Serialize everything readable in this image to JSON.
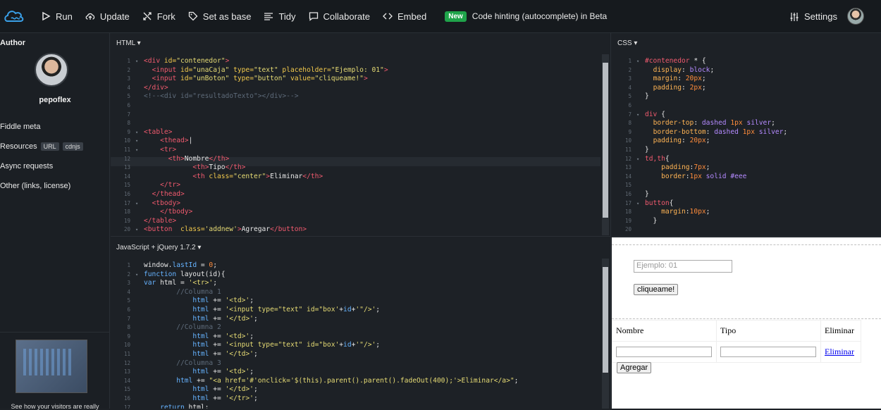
{
  "topbar": {
    "buttons": [
      {
        "label": "Run",
        "icon": "play-icon"
      },
      {
        "label": "Update",
        "icon": "cloud-upload-icon"
      },
      {
        "label": "Fork",
        "icon": "fork-icon"
      },
      {
        "label": "Set as base",
        "icon": "tag-icon"
      },
      {
        "label": "Tidy",
        "icon": "align-icon"
      },
      {
        "label": "Collaborate",
        "icon": "chat-icon"
      },
      {
        "label": "Embed",
        "icon": "code-icon"
      }
    ],
    "badge": "New",
    "hint": "Code hinting (autocomplete) in Beta",
    "settings_label": "Settings"
  },
  "sidebar": {
    "author_label": "Author",
    "username": "pepoflex",
    "items": [
      {
        "label": "Fiddle meta"
      },
      {
        "label": "Resources",
        "tags": [
          "URL",
          "cdnjs"
        ]
      },
      {
        "label": "Async requests"
      },
      {
        "label": "Other (links, license)"
      }
    ],
    "ad_text": "See how your visitors are really"
  },
  "panels": {
    "html_title": "HTML ▾",
    "css_title": "CSS ▾",
    "js_title": "JavaScript + jQuery 1.7.2 ▾"
  },
  "html_lines": [
    {
      "n": "1",
      "f": "▾",
      "s": [
        [
          "t",
          "<div "
        ],
        [
          "a",
          "id="
        ],
        [
          "s",
          "\"contenedor\""
        ],
        [
          "t",
          ">"
        ]
      ]
    },
    {
      "n": "2",
      "f": "",
      "s": [
        [
          "x",
          "  "
        ],
        [
          "t",
          "<input "
        ],
        [
          "a",
          "id="
        ],
        [
          "s",
          "\"unaCaja\" "
        ],
        [
          "a",
          "type="
        ],
        [
          "s",
          "\"text\" "
        ],
        [
          "a",
          "placeholder="
        ],
        [
          "s",
          "\"Ejemplo: 01\""
        ],
        [
          "t",
          ">"
        ]
      ]
    },
    {
      "n": "3",
      "f": "",
      "s": [
        [
          "x",
          "  "
        ],
        [
          "t",
          "<input "
        ],
        [
          "a",
          "id="
        ],
        [
          "s",
          "\"unBoton\" "
        ],
        [
          "a",
          "type="
        ],
        [
          "s",
          "\"button\" "
        ],
        [
          "a",
          "value="
        ],
        [
          "s",
          "\"cliqueame!\""
        ],
        [
          "t",
          ">"
        ]
      ]
    },
    {
      "n": "4",
      "f": "",
      "s": [
        [
          "t",
          "</div>"
        ]
      ]
    },
    {
      "n": "5",
      "f": "",
      "s": [
        [
          "c",
          "<!--<div id=\"resultadoTexto\"></div>-->"
        ]
      ]
    },
    {
      "n": "6",
      "f": "",
      "s": []
    },
    {
      "n": "7",
      "f": "",
      "s": []
    },
    {
      "n": "8",
      "f": "",
      "s": []
    },
    {
      "n": "9",
      "f": "▾",
      "s": [
        [
          "t",
          "<table>"
        ]
      ]
    },
    {
      "n": "10",
      "f": "▾",
      "s": [
        [
          "x",
          "    "
        ],
        [
          "t",
          "<thead>"
        ],
        [
          "x",
          "|"
        ]
      ]
    },
    {
      "n": "11",
      "f": "▾",
      "s": [
        [
          "x",
          "    "
        ],
        [
          "t",
          "<tr>"
        ]
      ]
    },
    {
      "n": "12",
      "f": "",
      "s": [
        [
          "x",
          "      "
        ],
        [
          "t",
          "<th>"
        ],
        [
          "x",
          "Nombre"
        ],
        [
          "t",
          "</th>"
        ]
      ]
    },
    {
      "n": "13",
      "f": "",
      "s": [
        [
          "x",
          "            "
        ],
        [
          "t",
          "<th>"
        ],
        [
          "x",
          "Tipo"
        ],
        [
          "t",
          "</th>"
        ]
      ]
    },
    {
      "n": "14",
      "f": "",
      "s": [
        [
          "x",
          "            "
        ],
        [
          "t",
          "<th "
        ],
        [
          "a",
          "class="
        ],
        [
          "s",
          "\"center\""
        ],
        [
          "t",
          ">"
        ],
        [
          "x",
          "Eliminar"
        ],
        [
          "t",
          "</th>"
        ]
      ]
    },
    {
      "n": "15",
      "f": "",
      "s": [
        [
          "x",
          "    "
        ],
        [
          "t",
          "</tr>"
        ]
      ]
    },
    {
      "n": "16",
      "f": "",
      "s": [
        [
          "x",
          "  "
        ],
        [
          "t",
          "</thead>"
        ]
      ]
    },
    {
      "n": "17",
      "f": "▾",
      "s": [
        [
          "x",
          "  "
        ],
        [
          "t",
          "<tbody>"
        ]
      ]
    },
    {
      "n": "18",
      "f": "",
      "s": [
        [
          "x",
          "    "
        ],
        [
          "t",
          "</tbody>"
        ]
      ]
    },
    {
      "n": "19",
      "f": "",
      "s": [
        [
          "t",
          "</table>"
        ]
      ]
    },
    {
      "n": "20",
      "f": "▾",
      "s": [
        [
          "t",
          "<button  "
        ],
        [
          "a",
          "class="
        ],
        [
          "s",
          "'addnew'"
        ],
        [
          "t",
          ">"
        ],
        [
          "x",
          "Agregar"
        ],
        [
          "t",
          "</button>"
        ]
      ]
    }
  ],
  "css_lines": [
    {
      "n": "1",
      "f": "▾",
      "s": [
        [
          "t",
          "#contenedor"
        ],
        [
          "x",
          " * {"
        ]
      ]
    },
    {
      "n": "2",
      "f": "",
      "s": [
        [
          "x",
          "  "
        ],
        [
          "p",
          "display"
        ],
        [
          "x",
          ": "
        ],
        [
          "v",
          "block"
        ],
        [
          "x",
          ";"
        ]
      ]
    },
    {
      "n": "3",
      "f": "",
      "s": [
        [
          "x",
          "  "
        ],
        [
          "p",
          "margin"
        ],
        [
          "x",
          ": "
        ],
        [
          "o",
          "20px"
        ],
        [
          "x",
          ";"
        ]
      ]
    },
    {
      "n": "4",
      "f": "",
      "s": [
        [
          "x",
          "  "
        ],
        [
          "p",
          "padding"
        ],
        [
          "x",
          ": "
        ],
        [
          "o",
          "2px"
        ],
        [
          "x",
          ";"
        ]
      ]
    },
    {
      "n": "5",
      "f": "",
      "s": [
        [
          "x",
          "}"
        ]
      ]
    },
    {
      "n": "6",
      "f": "",
      "s": []
    },
    {
      "n": "7",
      "f": "▾",
      "s": [
        [
          "t",
          "div"
        ],
        [
          "x",
          " {"
        ]
      ]
    },
    {
      "n": "8",
      "f": "",
      "s": [
        [
          "x",
          "  "
        ],
        [
          "p",
          "border-top"
        ],
        [
          "x",
          ": "
        ],
        [
          "v",
          "dashed "
        ],
        [
          "o",
          "1px "
        ],
        [
          "v",
          "silver"
        ],
        [
          "x",
          ";"
        ]
      ]
    },
    {
      "n": "9",
      "f": "",
      "s": [
        [
          "x",
          "  "
        ],
        [
          "p",
          "border-bottom"
        ],
        [
          "x",
          ": "
        ],
        [
          "v",
          "dashed "
        ],
        [
          "o",
          "1px "
        ],
        [
          "v",
          "silver"
        ],
        [
          "x",
          ";"
        ]
      ]
    },
    {
      "n": "10",
      "f": "",
      "s": [
        [
          "x",
          "  "
        ],
        [
          "p",
          "padding"
        ],
        [
          "x",
          ": "
        ],
        [
          "o",
          "20px"
        ],
        [
          "x",
          ";"
        ]
      ]
    },
    {
      "n": "11",
      "f": "",
      "s": [
        [
          "x",
          "}"
        ]
      ]
    },
    {
      "n": "12",
      "f": "▾",
      "s": [
        [
          "t",
          "td,th"
        ],
        [
          "x",
          "{"
        ]
      ]
    },
    {
      "n": "13",
      "f": "",
      "s": [
        [
          "x",
          "    "
        ],
        [
          "p",
          "padding"
        ],
        [
          "x",
          ":"
        ],
        [
          "o",
          "7px"
        ],
        [
          "x",
          ";"
        ]
      ]
    },
    {
      "n": "14",
      "f": "",
      "s": [
        [
          "x",
          "    "
        ],
        [
          "p",
          "border"
        ],
        [
          "x",
          ":"
        ],
        [
          "o",
          "1px "
        ],
        [
          "v",
          "solid "
        ],
        [
          "v",
          "#eee"
        ]
      ]
    },
    {
      "n": "15",
      "f": "",
      "s": []
    },
    {
      "n": "16",
      "f": "",
      "s": [
        [
          "x",
          "}"
        ]
      ]
    },
    {
      "n": "17",
      "f": "▾",
      "s": [
        [
          "t",
          "button"
        ],
        [
          "x",
          "{"
        ]
      ]
    },
    {
      "n": "18",
      "f": "",
      "s": [
        [
          "x",
          "    "
        ],
        [
          "p",
          "margin"
        ],
        [
          "x",
          ":"
        ],
        [
          "o",
          "10px"
        ],
        [
          "x",
          ";"
        ]
      ]
    },
    {
      "n": "19",
      "f": "",
      "s": [
        [
          "x",
          "  }"
        ]
      ]
    },
    {
      "n": "20",
      "f": "",
      "s": []
    }
  ],
  "js_lines": [
    {
      "n": "1",
      "f": "",
      "s": [
        [
          "x",
          "window."
        ],
        [
          "k",
          "lastId"
        ],
        [
          "x",
          " = "
        ],
        [
          "o",
          "0"
        ],
        [
          "x",
          ";"
        ]
      ]
    },
    {
      "n": "2",
      "f": "▾",
      "s": [
        [
          "k",
          "function "
        ],
        [
          "x",
          "layout(id){"
        ]
      ]
    },
    {
      "n": "3",
      "f": "",
      "s": [
        [
          "k",
          "var "
        ],
        [
          "x",
          "html = "
        ],
        [
          "s",
          "'<tr>'"
        ],
        [
          "x",
          ";"
        ]
      ]
    },
    {
      "n": "4",
      "f": "",
      "s": [
        [
          "x",
          "        "
        ],
        [
          "c",
          "//Columna 1"
        ]
      ]
    },
    {
      "n": "5",
      "f": "",
      "s": [
        [
          "x",
          "            "
        ],
        [
          "k",
          "html"
        ],
        [
          "x",
          " += "
        ],
        [
          "s",
          "'<td>'"
        ],
        [
          "x",
          ";"
        ]
      ]
    },
    {
      "n": "6",
      "f": "",
      "s": [
        [
          "x",
          "            "
        ],
        [
          "k",
          "html"
        ],
        [
          "x",
          " += "
        ],
        [
          "s",
          "'<input type=\"text\" id=\"box'"
        ],
        [
          "x",
          "+"
        ],
        [
          "k",
          "id"
        ],
        [
          "x",
          "+"
        ],
        [
          "s",
          "'\"/>'"
        ],
        [
          "x",
          ";"
        ]
      ]
    },
    {
      "n": "7",
      "f": "",
      "s": [
        [
          "x",
          "            "
        ],
        [
          "k",
          "html"
        ],
        [
          "x",
          " += "
        ],
        [
          "s",
          "'</td>'"
        ],
        [
          "x",
          ";"
        ]
      ]
    },
    {
      "n": "8",
      "f": "",
      "s": [
        [
          "x",
          "        "
        ],
        [
          "c",
          "//Columna 2"
        ]
      ]
    },
    {
      "n": "9",
      "f": "",
      "s": [
        [
          "x",
          "            "
        ],
        [
          "k",
          "html"
        ],
        [
          "x",
          " += "
        ],
        [
          "s",
          "'<td>'"
        ],
        [
          "x",
          ";"
        ]
      ]
    },
    {
      "n": "10",
      "f": "",
      "s": [
        [
          "x",
          "            "
        ],
        [
          "k",
          "html"
        ],
        [
          "x",
          " += "
        ],
        [
          "s",
          "'<input type=\"text\" id=\"box'"
        ],
        [
          "x",
          "+"
        ],
        [
          "k",
          "id"
        ],
        [
          "x",
          "+"
        ],
        [
          "s",
          "'\"/>'"
        ],
        [
          "x",
          ";"
        ]
      ]
    },
    {
      "n": "11",
      "f": "",
      "s": [
        [
          "x",
          "            "
        ],
        [
          "k",
          "html"
        ],
        [
          "x",
          " += "
        ],
        [
          "s",
          "'</td>'"
        ],
        [
          "x",
          ";"
        ]
      ]
    },
    {
      "n": "12",
      "f": "",
      "s": [
        [
          "x",
          "        "
        ],
        [
          "c",
          "//Columna 3"
        ]
      ]
    },
    {
      "n": "13",
      "f": "",
      "s": [
        [
          "x",
          "            "
        ],
        [
          "k",
          "html"
        ],
        [
          "x",
          " += "
        ],
        [
          "s",
          "'<td>'"
        ],
        [
          "x",
          ";"
        ]
      ]
    },
    {
      "n": "14",
      "f": "",
      "s": [
        [
          "x",
          "        "
        ],
        [
          "k",
          "html"
        ],
        [
          "x",
          " += "
        ],
        [
          "s",
          "\"<a href='#'onclick='$(this).parent().parent().fadeOut(400);'>Eliminar</a>\""
        ],
        [
          "x",
          ";"
        ]
      ]
    },
    {
      "n": "15",
      "f": "",
      "s": [
        [
          "x",
          "            "
        ],
        [
          "k",
          "html"
        ],
        [
          "x",
          " += "
        ],
        [
          "s",
          "'</td>'"
        ],
        [
          "x",
          ";"
        ]
      ]
    },
    {
      "n": "16",
      "f": "",
      "s": [
        [
          "x",
          "            "
        ],
        [
          "k",
          "html"
        ],
        [
          "x",
          " += "
        ],
        [
          "s",
          "'</tr>'"
        ],
        [
          "x",
          ";"
        ]
      ]
    },
    {
      "n": "17",
      "f": "",
      "s": [
        [
          "x",
          "    "
        ],
        [
          "k",
          "return "
        ],
        [
          "x",
          "html;"
        ]
      ]
    }
  ],
  "result": {
    "input_placeholder": "Ejemplo: 01",
    "button_label": "cliqueame!",
    "headers": [
      "Nombre",
      "Tipo",
      "Eliminar"
    ],
    "row_link": "Eliminar",
    "add_button": "Agregar"
  }
}
